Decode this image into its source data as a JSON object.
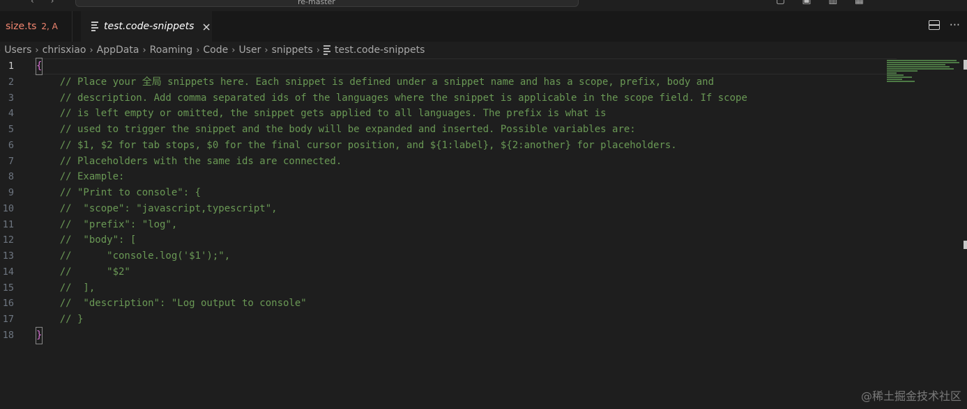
{
  "titlebar": {
    "nav_glyphs": "‹ ›",
    "command_center": "re-master",
    "window_glyphs": "▢ ▣ ▥ ▦"
  },
  "tabs": [
    {
      "label": "size.ts",
      "badge": "2, A",
      "active": false
    },
    {
      "label": "test.code-snippets",
      "close": "×",
      "active": true
    }
  ],
  "tab_actions": {
    "more": "···"
  },
  "breadcrumb": {
    "items": [
      "Users",
      "chrisxiao",
      "AppData",
      "Roaming",
      "Code",
      "User",
      "snippets"
    ],
    "file": "test.code-snippets",
    "separator": "›"
  },
  "editor": {
    "current_line": 1,
    "lines": [
      {
        "n": "1",
        "text": "{"
      },
      {
        "n": "2",
        "text": "    // Place your 全局 snippets here. Each snippet is defined under a snippet name and has a scope, prefix, body and"
      },
      {
        "n": "3",
        "text": "    // description. Add comma separated ids of the languages where the snippet is applicable in the scope field. If scope"
      },
      {
        "n": "4",
        "text": "    // is left empty or omitted, the snippet gets applied to all languages. The prefix is what is"
      },
      {
        "n": "5",
        "text": "    // used to trigger the snippet and the body will be expanded and inserted. Possible variables are:"
      },
      {
        "n": "6",
        "text": "    // $1, $2 for tab stops, $0 for the final cursor position, and ${1:label}, ${2:another} for placeholders."
      },
      {
        "n": "7",
        "text": "    // Placeholders with the same ids are connected."
      },
      {
        "n": "8",
        "text": "    // Example:"
      },
      {
        "n": "9",
        "text": "    // \"Print to console\": {"
      },
      {
        "n": "10",
        "text": "    //  \"scope\": \"javascript,typescript\","
      },
      {
        "n": "11",
        "text": "    //  \"prefix\": \"log\","
      },
      {
        "n": "12",
        "text": "    //  \"body\": ["
      },
      {
        "n": "13",
        "text": "    //      \"console.log('$1');\","
      },
      {
        "n": "14",
        "text": "    //      \"$2\""
      },
      {
        "n": "15",
        "text": "    //  ],"
      },
      {
        "n": "16",
        "text": "    //  \"description\": \"Log output to console\""
      },
      {
        "n": "17",
        "text": "    // }"
      },
      {
        "n": "18",
        "text": "}"
      }
    ]
  },
  "watermark": "@稀土掘金技术社区",
  "colors": {
    "background": "#1e1e1e",
    "comment": "#6a9955",
    "bracket": "#da70d6",
    "error_tab": "#f48771"
  }
}
